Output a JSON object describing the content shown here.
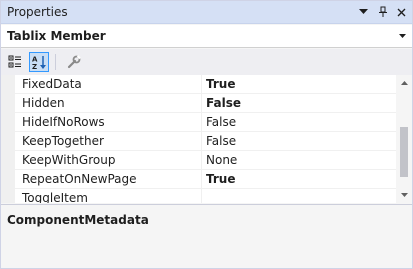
{
  "window": {
    "title": "Properties",
    "buttons": {
      "dropdown_icon": "chevron-down-icon",
      "pin_icon": "pin-icon",
      "close_icon": "close-icon"
    }
  },
  "object_selector": {
    "value": "Tablix Member"
  },
  "toolbar": {
    "categorized_icon": "categorized-icon",
    "alphabetical_icon": "alphabetical-icon",
    "property_pages_icon": "wrench-icon"
  },
  "properties": [
    {
      "name": "FixedData",
      "value": "True",
      "bold": true
    },
    {
      "name": "Hidden",
      "value": "False",
      "bold": true
    },
    {
      "name": "HideIfNoRows",
      "value": "False",
      "bold": false
    },
    {
      "name": "KeepTogether",
      "value": "False",
      "bold": false
    },
    {
      "name": "KeepWithGroup",
      "value": "None",
      "bold": false
    },
    {
      "name": "RepeatOnNewPage",
      "value": "True",
      "bold": true
    },
    {
      "name": "ToggleItem",
      "value": "",
      "bold": false
    }
  ],
  "description": {
    "title": "ComponentMetadata"
  },
  "colors": {
    "titlebar": "#d5e0f5",
    "active_tool": "#c9def5",
    "accent": "#3399ff",
    "gutter": "#f0f0f0"
  }
}
